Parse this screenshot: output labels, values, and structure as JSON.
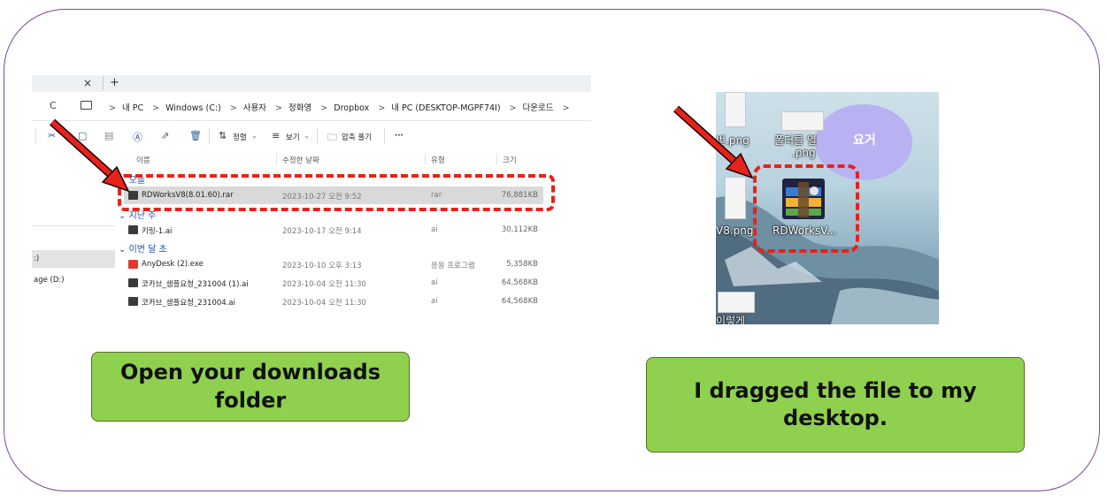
{
  "explorer": {
    "tab_close": "×",
    "tab_plus": "+",
    "refresh_icon": "C",
    "breadcrumb": [
      "내 PC",
      "Windows (C:)",
      "사용자",
      "정화영",
      "Dropbox",
      "내 PC (DESKTOP-MGPF74I)",
      "다운로드"
    ],
    "toolbar": {
      "sort_label": "정렬",
      "view_label": "보기",
      "extract_label": "압축 풀기",
      "more_label": "···"
    },
    "columns": {
      "name": "이름",
      "modified": "수정한 날짜",
      "type": "유형",
      "size": "크기"
    },
    "groups": {
      "today": "오늘",
      "earlier_this_week": "지난 주",
      "this_month": "이번 달 초"
    },
    "files": [
      {
        "name": "RDWorksV8(8.01.60).rar",
        "modified": "2023-10-27 오전 9:52",
        "type": "rar",
        "size": "76,881KB"
      },
      {
        "name": "키링-1.ai",
        "modified": "2023-10-17 오전 9:14",
        "type": "ai",
        "size": "30,112KB"
      },
      {
        "name": "AnyDesk (2).exe",
        "modified": "2023-10-10 오후 3:13",
        "type": "응용 프로그램",
        "size": "5,358KB"
      },
      {
        "name": "코카브_샘플요청_231004 (1).ai",
        "modified": "2023-10-04 오전 11:30",
        "type": "ai",
        "size": "64,568KB"
      },
      {
        "name": "코카브_샘플요청_231004.ai",
        "modified": "2023-10-04 오전 11:30",
        "type": "ai",
        "size": "64,568KB"
      }
    ],
    "navpane": {
      "drive_c": ":)",
      "drive_d": "age (D:)"
    }
  },
  "desktop": {
    "bubble_text": "요거",
    "labels": {
      "top_left": "번.png",
      "top_middle": "폴더를 열",
      "top_middle_2": ".png",
      "mid_left": "V8.png",
      "rdworks": "RDWorksV...",
      "bottom_left": "이렇게"
    }
  },
  "callouts": {
    "left": "Open your downloads folder",
    "right": "I dragged the file to my desktop."
  },
  "colors": {
    "highlight": "#e8221b",
    "callout": "#8fd14f",
    "frame": "#7a4a9a"
  }
}
